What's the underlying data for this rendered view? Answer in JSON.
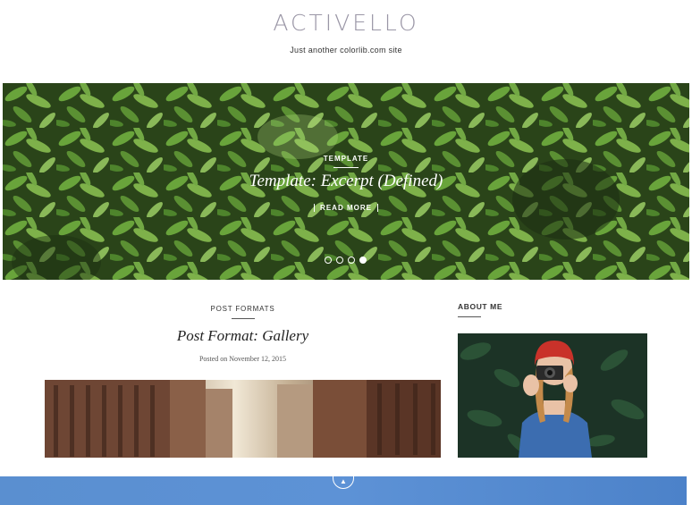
{
  "site": {
    "title": "ACTIVELLO",
    "tagline": "Just another colorlib.com site"
  },
  "hero": {
    "category": "TEMPLATE",
    "title": "Template: Excerpt (Defined)",
    "button_label": "READ MORE",
    "slides_count": 4,
    "active_slide": 4
  },
  "post": {
    "category": "POST FORMATS",
    "title": "Post Format: Gallery",
    "meta": "Posted on November 12, 2015"
  },
  "sidebar": {
    "widget_title": "ABOUT ME"
  },
  "bottom_bar": {
    "scroll_icon": "arrow-up-icon"
  },
  "colors": {
    "logo": "#9a96a6",
    "bottom_bar": "#5a8fd0",
    "foliage_dark": "#2f4a1a",
    "foliage_light": "#8bc34a"
  }
}
